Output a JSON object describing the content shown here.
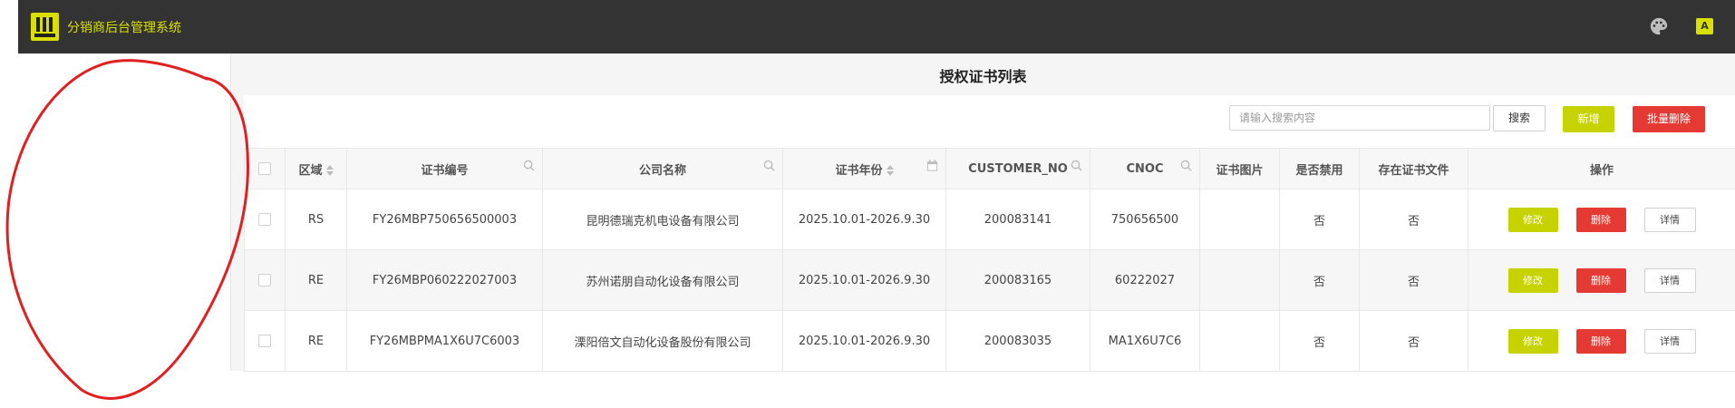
{
  "app": {
    "title": "分销商后台管理系统",
    "logo_text": "IN",
    "accent": "#d9e000",
    "topbar_color": "#333333"
  },
  "header_icons": [
    "palette-icon",
    "translate-icon"
  ],
  "page": {
    "title": "授权证书列表"
  },
  "toolbar": {
    "search_placeholder": "请输入搜索内容",
    "search_label": "搜索",
    "add_label": "新增",
    "batch_delete_label": "批量删除"
  },
  "table": {
    "columns": [
      "区域",
      "证书编号",
      "公司名称",
      "证书年份",
      "CUSTOMER_NO",
      "CNOC",
      "证书图片",
      "是否禁用",
      "存在证书文件",
      "操作"
    ],
    "rows": [
      {
        "region": "RS",
        "cert_no": "FY26MBP750656500003",
        "company": "昆明德瑞克机电设备有限公司",
        "year": "2025.10.01-2026.9.30",
        "customer_no": "200083141",
        "cnoc": "750656500",
        "image": "",
        "disabled": "否",
        "has_file": "否"
      },
      {
        "region": "RE",
        "cert_no": "FY26MBP060222027003",
        "company": "苏州诺朋自动化设备有限公司",
        "year": "2025.10.01-2026.9.30",
        "customer_no": "200083165",
        "cnoc": "60222027",
        "image": "",
        "disabled": "否",
        "has_file": "否"
      },
      {
        "region": "RE",
        "cert_no": "FY26MBPMA1X6U7C6003",
        "company": "溧阳倍文自动化设备股份有限公司",
        "year": "2025.10.01-2026.9.30",
        "customer_no": "200083035",
        "cnoc": "MA1X6U7C6",
        "image": "",
        "disabled": "否",
        "has_file": "否"
      }
    ],
    "actions": {
      "edit": "修改",
      "delete": "删除",
      "detail": "详情"
    }
  },
  "colors": {
    "primary": "#c7d300",
    "danger": "#e53a33",
    "annotation": "#e02020"
  }
}
